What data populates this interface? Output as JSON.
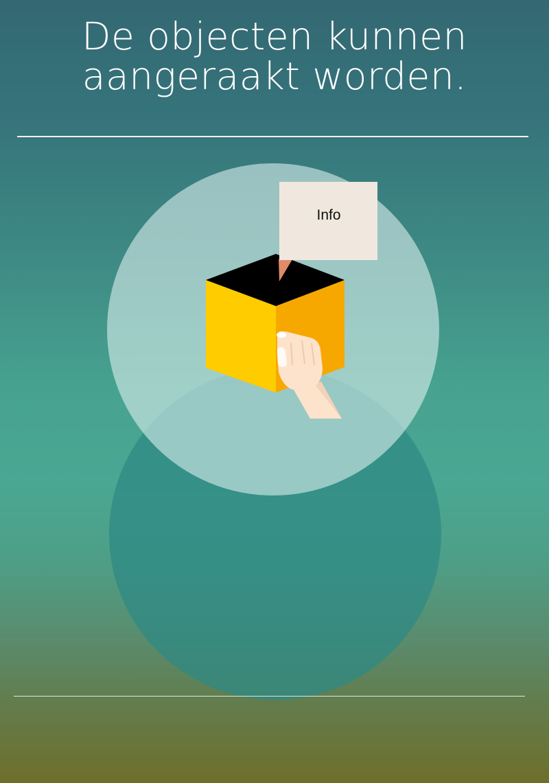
{
  "title": {
    "line1": "De objecten kunnen",
    "line2": "aangeraakt worden."
  },
  "info_card": {
    "label": "Info"
  },
  "colors": {
    "upper_circle": "#b5dcd6",
    "lower_circle": "#2f8a84",
    "cube_front": "#ffcc00",
    "cube_side": "#f7a800",
    "cube_top": "#000000",
    "card": "#f0e8de",
    "card_pointer": "#e08a6a",
    "hand": "#fde3cc"
  },
  "icons": {
    "cube": "cube-icon",
    "hand": "hand-icon"
  }
}
